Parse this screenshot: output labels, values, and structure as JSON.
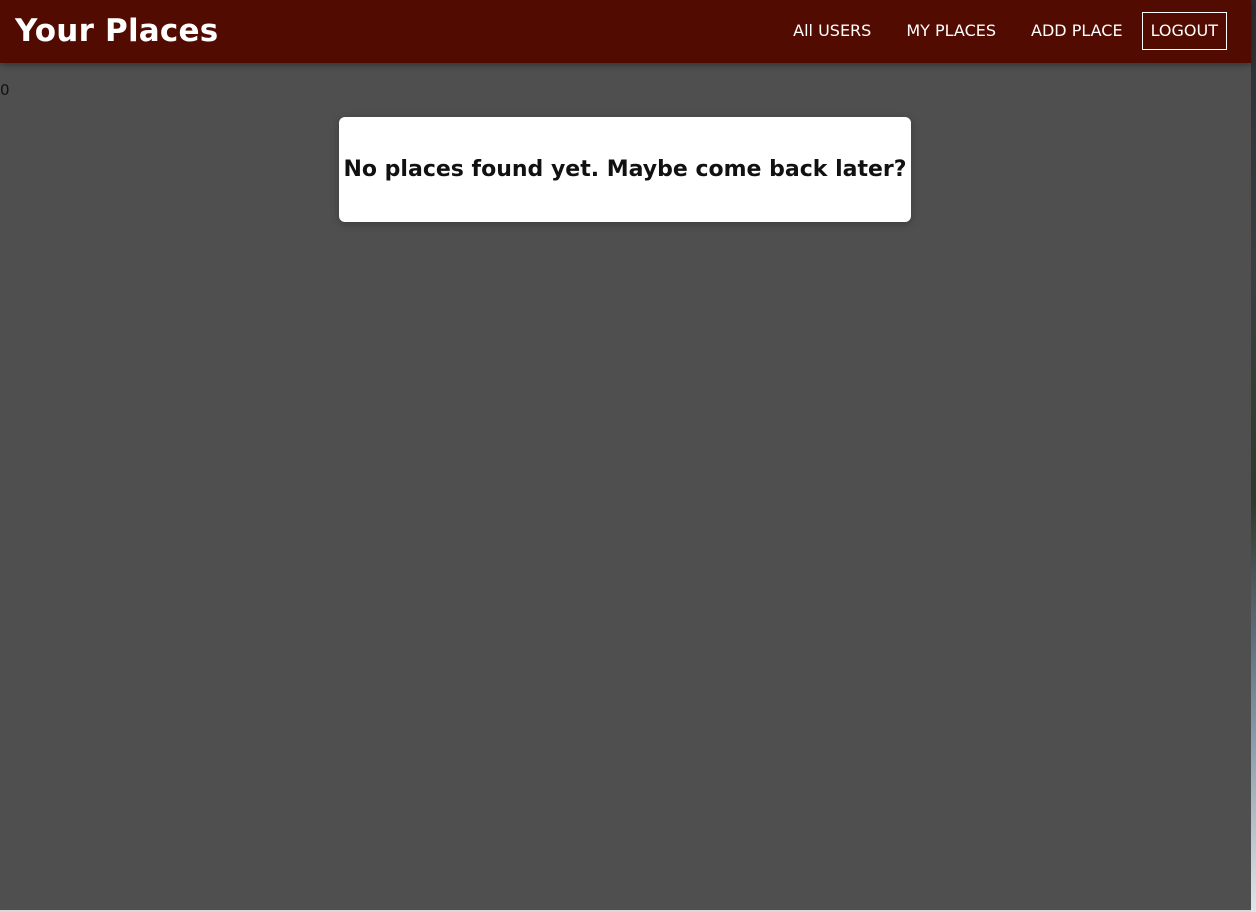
{
  "header": {
    "brand_title": "Your Places",
    "background_color": "#520b01",
    "nav": {
      "all_users": "All USERS",
      "my_places": "MY PLACES",
      "add_place": "ADD PLACE",
      "logout": "LOGOUT"
    }
  },
  "main": {
    "count": "0",
    "empty_message": "No places found yet. Maybe come back later?",
    "background_color": "#4f4f4f"
  }
}
